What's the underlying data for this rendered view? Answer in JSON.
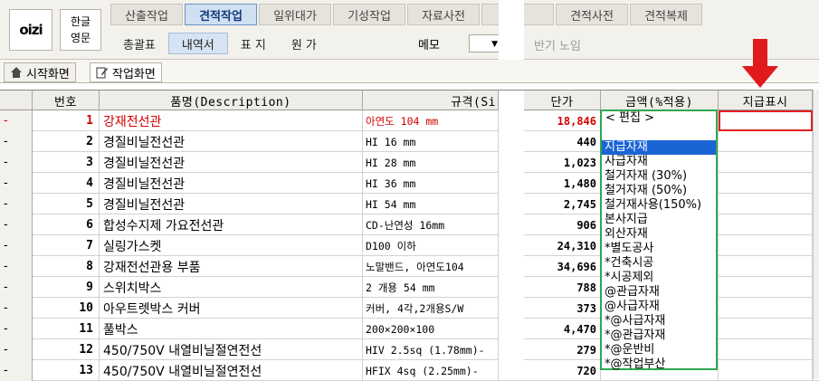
{
  "app": {
    "logo_text": "oizi",
    "lang": [
      "한글",
      "영문"
    ]
  },
  "tabs": [
    {
      "label": "산출작업",
      "active": false
    },
    {
      "label": "견적작업",
      "active": true
    },
    {
      "label": "일위대가",
      "active": false
    },
    {
      "label": "기성작업",
      "active": false
    },
    {
      "label": "자료사전",
      "active": false
    },
    {
      "label": "",
      "active": false
    },
    {
      "label": "견적사전",
      "active": false
    },
    {
      "label": "견적복제",
      "active": false
    }
  ],
  "subtabs": [
    {
      "label": "총괄표",
      "active": false
    },
    {
      "label": "내역서",
      "active": true
    },
    {
      "label": "표 지",
      "active": false
    },
    {
      "label": "원 가",
      "active": false
    }
  ],
  "memo_label": "메모",
  "right_ghost": "반기 노임",
  "view_tabs": [
    "시작화면",
    "작업화면"
  ],
  "grid": {
    "headers": [
      "번호",
      "품명(Description)",
      "규격(Si",
      "단가",
      "금액(%적용)",
      "지급표시"
    ],
    "rows": [
      {
        "mark": "-",
        "no": "1",
        "name": "강재전선관",
        "spec": "아연도 104 mm",
        "price": "18,846",
        "highlight": true
      },
      {
        "mark": "-",
        "no": "2",
        "name": "경질비닐전선관",
        "spec": "HI 16 mm",
        "price": "440"
      },
      {
        "mark": "-",
        "no": "3",
        "name": "경질비닐전선관",
        "spec": "HI 28 mm",
        "price": "1,023"
      },
      {
        "mark": "-",
        "no": "4",
        "name": "경질비닐전선관",
        "spec": "HI 36 mm",
        "price": "1,480"
      },
      {
        "mark": "-",
        "no": "5",
        "name": "경질비닐전선관",
        "spec": "HI 54 mm",
        "price": "2,745"
      },
      {
        "mark": "-",
        "no": "6",
        "name": "합성수지제 가요전선관",
        "spec": "CD-난연성 16mm",
        "price": "906"
      },
      {
        "mark": "-",
        "no": "7",
        "name": "실링가스켓",
        "spec": "D100 이하",
        "price": "24,310"
      },
      {
        "mark": "-",
        "no": "8",
        "name": "강재전선관용 부품",
        "spec": "노말밴드, 아연도104",
        "price": "34,696"
      },
      {
        "mark": "-",
        "no": "9",
        "name": "스위치박스",
        "spec": "2 개용 54 mm",
        "price": "788"
      },
      {
        "mark": "-",
        "no": "10",
        "name": "아우트렛박스 커버",
        "spec": "커버, 4각,2개용S/W",
        "price": "373"
      },
      {
        "mark": "-",
        "no": "11",
        "name": "풀박스",
        "spec": "200×200×100",
        "price": "4,470"
      },
      {
        "mark": "-",
        "no": "12",
        "name": "450/750V 내열비닐절연전선",
        "spec": "HIV 2.5sq (1.78mm)-",
        "price": "279"
      },
      {
        "mark": "-",
        "no": "13",
        "name": "450/750V 내열비닐절연전선",
        "spec": "HFIX 4sq (2.25mm)-",
        "price": "720"
      }
    ]
  },
  "dropdown": {
    "header": "< 편집 >",
    "items": [
      "지급자재",
      "사급자재",
      "철거자재 (30%)",
      "철거자재 (50%)",
      "철거재사용(150%)",
      "본사지급",
      "외산자재",
      "*별도공사",
      "*건축시공",
      "*시공제외",
      "@관급자재",
      "@사급자재",
      "*@사급자재",
      "*@관급자재",
      "*@운반비",
      "*@작업부산"
    ],
    "selected_index": 0
  },
  "colors": {
    "accent_red": "#e11b1b",
    "dropdown_border": "#2fa84f",
    "selection_blue": "#1a64d6"
  }
}
